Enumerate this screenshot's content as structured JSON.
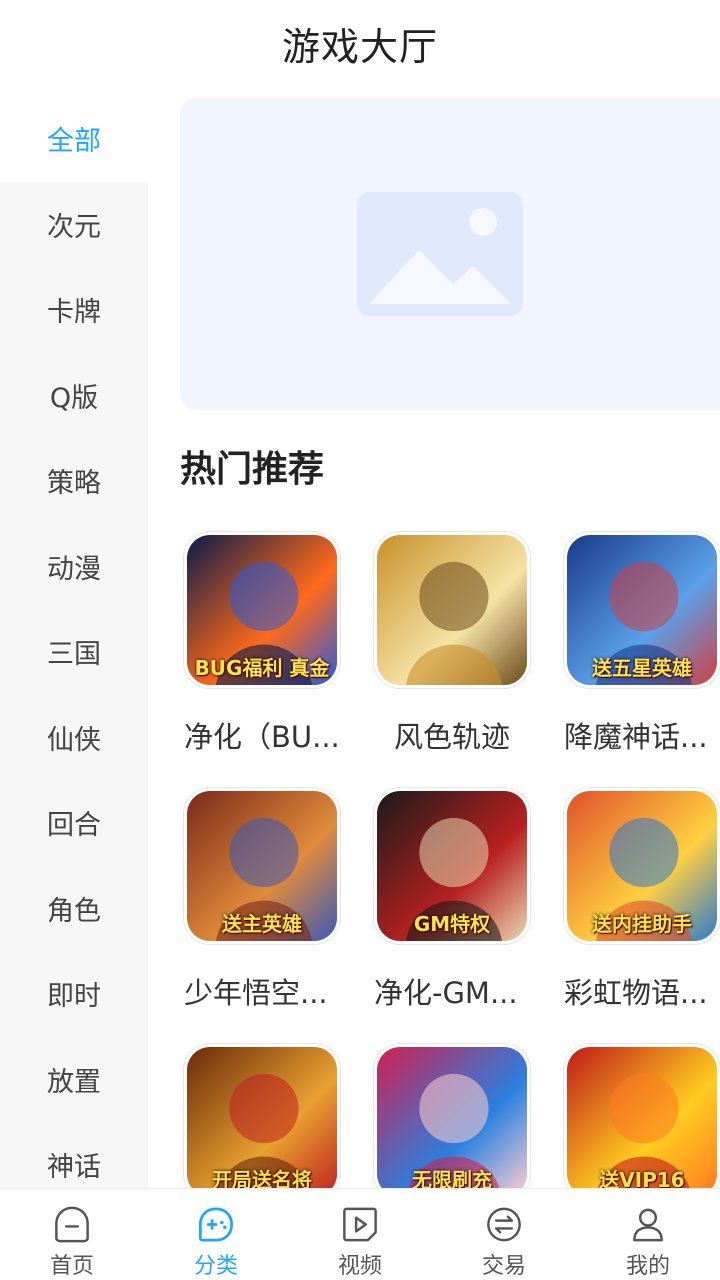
{
  "header": {
    "title": "游戏大厅"
  },
  "sidebar": {
    "items": [
      {
        "label": "全部",
        "active": true
      },
      {
        "label": "次元"
      },
      {
        "label": "卡牌"
      },
      {
        "label": "Q版"
      },
      {
        "label": "策略"
      },
      {
        "label": "动漫"
      },
      {
        "label": "三国"
      },
      {
        "label": "仙侠"
      },
      {
        "label": "回合"
      },
      {
        "label": "角色"
      },
      {
        "label": "即时"
      },
      {
        "label": "放置"
      },
      {
        "label": "神话"
      }
    ]
  },
  "banner": {
    "icon": "image-placeholder-icon"
  },
  "section": {
    "title": "热门推荐"
  },
  "games": [
    {
      "name": "净化（BU...",
      "badge": "BUG福利 真金",
      "colors": [
        "#0b1b4a",
        "#ff6a1a",
        "#2a5bd8"
      ]
    },
    {
      "name": "风色轨迹",
      "colors": [
        "#c9902a",
        "#f5e3a6",
        "#6b4a1a"
      ]
    },
    {
      "name": "降魔神话...",
      "badge": "送五星英雄",
      "colors": [
        "#1a3a8a",
        "#5aa0e8",
        "#d04040"
      ]
    },
    {
      "name": "少年悟空...",
      "badge": "送主英雄",
      "colors": [
        "#7a2a1a",
        "#e08a3a",
        "#3a5ab8"
      ]
    },
    {
      "name": "净化-GM...",
      "badge": "GM特权",
      "colors": [
        "#1a1a1a",
        "#b82020",
        "#e8d8b0"
      ]
    },
    {
      "name": "彩虹物语...",
      "badge": "送内挂助手",
      "colors": [
        "#e0502a",
        "#ffd040",
        "#2a7ad0"
      ]
    },
    {
      "name": "",
      "badge": "开局送名将",
      "colors": [
        "#6a2a0a",
        "#e8a030",
        "#c02020"
      ]
    },
    {
      "name": "",
      "badge": "无限刷充",
      "colors": [
        "#d02050",
        "#2a80e0",
        "#ffd0d0"
      ]
    },
    {
      "name": "",
      "badge": "送VIP16",
      "colors": [
        "#c01a1a",
        "#ffcc20",
        "#ff7a20"
      ]
    }
  ],
  "tabbar": {
    "tabs": [
      {
        "label": "首页",
        "icon": "home-icon"
      },
      {
        "label": "分类",
        "icon": "category-icon",
        "active": true
      },
      {
        "label": "视频",
        "icon": "video-icon"
      },
      {
        "label": "交易",
        "icon": "trade-icon"
      },
      {
        "label": "我的",
        "icon": "profile-icon"
      }
    ]
  },
  "colors": {
    "accent": "#1ea7ff",
    "sidebar_bg": "#f7f7f8",
    "banner_bg": "#f1f5fd"
  }
}
